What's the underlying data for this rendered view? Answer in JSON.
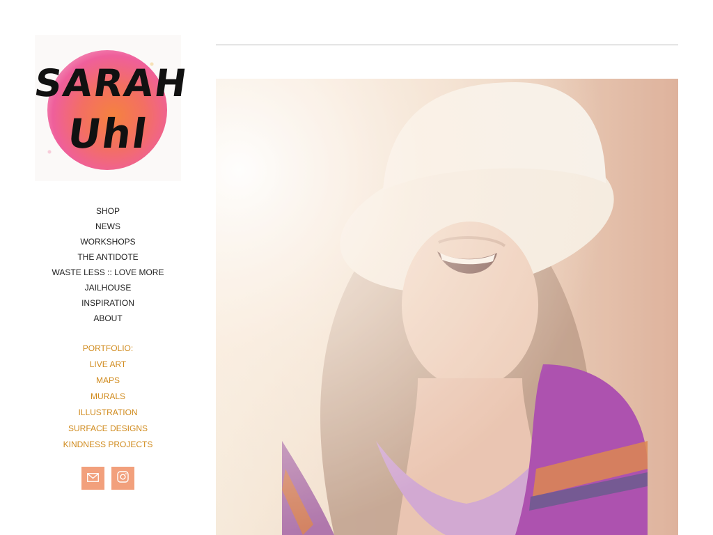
{
  "logo": {
    "line1": "SARAH",
    "line2": "Uhl"
  },
  "nav": {
    "items": [
      "SHOP",
      "NEWS",
      "WORKSHOPS",
      "THE ANTIDOTE",
      "WASTE LESS :: LOVE MORE",
      "JAILHOUSE",
      "INSPIRATION",
      "ABOUT"
    ]
  },
  "portfolio": {
    "heading": "PORTFOLIO:",
    "items": [
      "LIVE ART",
      "MAPS",
      "MURALS",
      "ILLUSTRATION",
      "SURFACE DESIGNS",
      "KINDNESS PROJECTS"
    ]
  },
  "social": {
    "icons": [
      "mail-icon",
      "instagram-icon"
    ]
  },
  "colors": {
    "nav_text": "#222222",
    "accent": "#d08a1c",
    "social_bg": "#f2a07c",
    "rule": "#b9b9b9"
  }
}
